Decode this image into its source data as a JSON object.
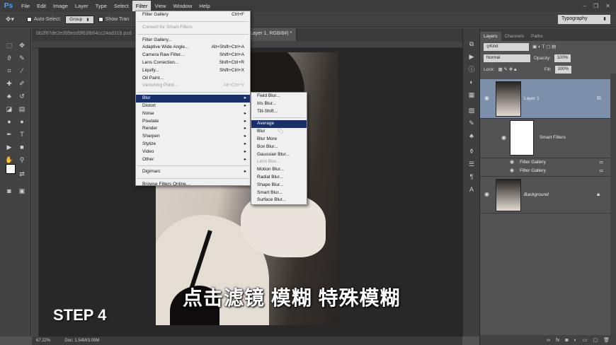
{
  "app": {
    "logo": "Ps"
  },
  "menubar": {
    "items": [
      "File",
      "Edit",
      "Image",
      "Layer",
      "Type",
      "Select",
      "Filter",
      "View",
      "Window",
      "Help"
    ],
    "window_buttons": [
      "–",
      "❐",
      "✕"
    ]
  },
  "options": {
    "auto_select_label": "Auto-Select:",
    "group_value": "Group",
    "show_transform_label": "Show Tran",
    "workspace": "Typography"
  },
  "document": {
    "tab_left": "bb2f87de2e399ecd9f63fb64cc24ad31b.psd",
    "tab_active": "2% (Layer 1, RGB/8#) *"
  },
  "filter_menu": {
    "items": [
      {
        "label": "Filter Gallery",
        "shortcut": "Ctrl+F"
      },
      {
        "sep": true
      },
      {
        "label": "Convert for Smart Filters",
        "disabled": true
      },
      {
        "sep": true
      },
      {
        "label": "Filter Gallery..."
      },
      {
        "label": "Adaptive Wide Angle...",
        "shortcut": "Alt+Shift+Ctrl+A"
      },
      {
        "label": "Camera Raw Filter...",
        "shortcut": "Shift+Ctrl+A"
      },
      {
        "label": "Lens Correction...",
        "shortcut": "Shift+Ctrl+R"
      },
      {
        "label": "Liquify...",
        "shortcut": "Shift+Ctrl+X"
      },
      {
        "label": "Oil Paint..."
      },
      {
        "label": "Vanishing Point...",
        "shortcut": "Alt+Ctrl+V",
        "disabled": true
      },
      {
        "sep": true
      },
      {
        "label": "Blur",
        "sub": true,
        "highlight": true
      },
      {
        "label": "Distort",
        "sub": true
      },
      {
        "label": "Noise",
        "sub": true
      },
      {
        "label": "Pixelate",
        "sub": true
      },
      {
        "label": "Render",
        "sub": true
      },
      {
        "label": "Sharpen",
        "sub": true
      },
      {
        "label": "Stylize",
        "sub": true
      },
      {
        "label": "Video",
        "sub": true
      },
      {
        "label": "Other",
        "sub": true
      },
      {
        "sep": true
      },
      {
        "label": "Digimarc",
        "sub": true
      },
      {
        "sep": true
      },
      {
        "label": "Browse Filters Online..."
      }
    ]
  },
  "blur_submenu": {
    "items": [
      {
        "label": "Field Blur..."
      },
      {
        "label": "Iris Blur..."
      },
      {
        "label": "Tilt-Shift..."
      },
      {
        "sep": true
      },
      {
        "label": "Average",
        "highlight": true
      },
      {
        "label": "Blur"
      },
      {
        "label": "Blur More"
      },
      {
        "label": "Box Blur..."
      },
      {
        "label": "Gaussian Blur..."
      },
      {
        "label": "Lens Blur...",
        "disabled": true
      },
      {
        "label": "Motion Blur..."
      },
      {
        "label": "Radial Blur..."
      },
      {
        "label": "Shape Blur..."
      },
      {
        "label": "Smart Blur..."
      },
      {
        "label": "Surface Blur..."
      }
    ]
  },
  "layers_panel": {
    "tabs": [
      "Layers",
      "Channels",
      "Paths"
    ],
    "kind_label": "Kind",
    "blend_mode": "Normal",
    "opacity_label": "Opacity:",
    "opacity_value": "100%",
    "lock_label": "Lock:",
    "fill_label": "Fill:",
    "fill_value": "100%",
    "layers": {
      "layer1": "Layer 1",
      "smart_filters": "Smart Filters",
      "filter_gallery_1": "Filter Gallery",
      "filter_gallery_2": "Filter Gallery",
      "background": "Background"
    }
  },
  "status": {
    "zoom": "67.22%",
    "doc": "Doc: 1.54M/3.09M"
  },
  "overlay": {
    "caption": "点击滤镜 模糊 特殊模糊",
    "step": "STEP 4"
  }
}
